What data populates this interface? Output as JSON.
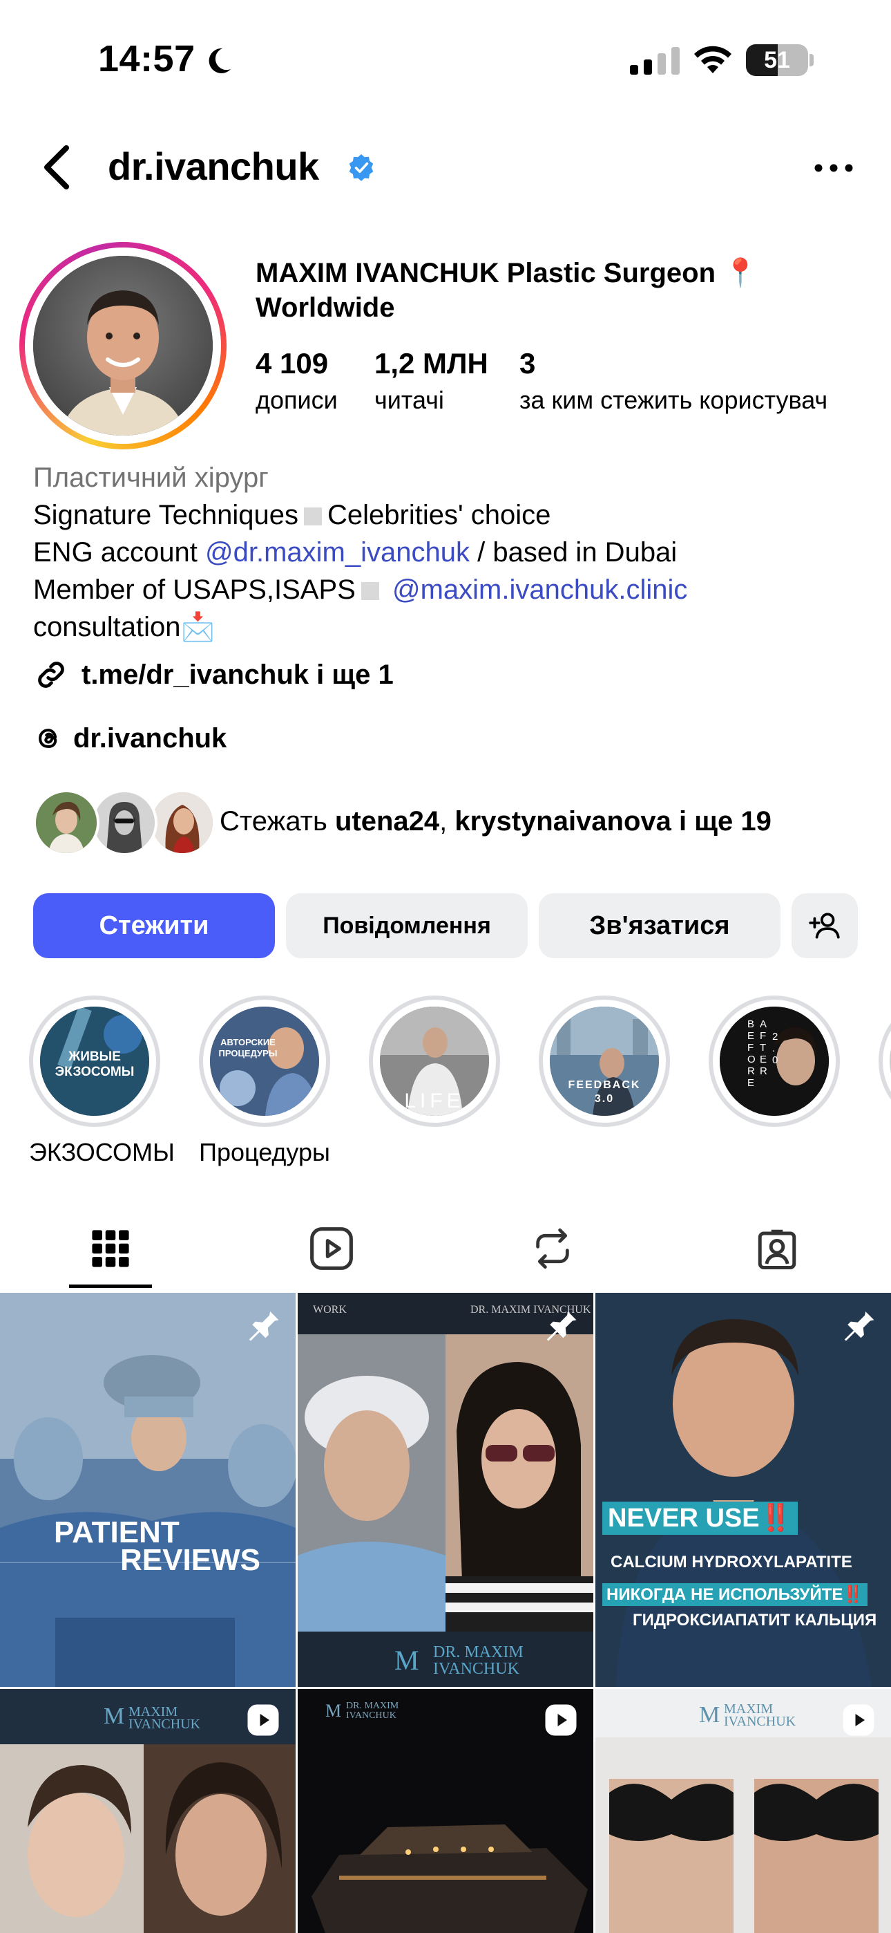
{
  "status_bar": {
    "time": "14:57",
    "battery": "51",
    "battery_level": 0.51
  },
  "header": {
    "username": "dr.ivanchuk"
  },
  "profile": {
    "full_name": "MAXIM IVANCHUK Plastic Surgeon 📍 Worldwide",
    "stats": [
      {
        "value": "4 109",
        "label": "дописи"
      },
      {
        "value": "1,2 МЛН",
        "label": "читачі"
      },
      {
        "value": "3",
        "label": "за ким стежить користувач"
      }
    ],
    "bio": {
      "category": "Пластичний хірург",
      "line1a": "Signature Techniques",
      "line1b": "Celebrities' choice",
      "line2a": "ENG account",
      "line2_link": "@dr.maxim_ivanchuk",
      "line2b": "/ based in Dubai",
      "line3a": "Member of USAPS,ISAPS",
      "line3_link": "@maxim.ivanchuk.clinic",
      "line4": "consultation📩"
    },
    "link": "t.me/dr_ivanchuk і ще 1",
    "threads": "dr.ivanchuk",
    "followed_by": {
      "prefix": "Стежать",
      "user1": "utena24",
      "sep": ",",
      "user2": "krystynaivanova",
      "suffix": "і ще 19"
    }
  },
  "actions": {
    "follow": "Стежити",
    "message": "Повідомлення",
    "contact": "Зв'язатися"
  },
  "highlights": [
    {
      "label": "ЭКЗОСОМЫ",
      "cover_text": "ЖИВЫЕ ЭКЗОСОМЫ"
    },
    {
      "label": "Процедуры",
      "cover_text": "АВТОРСКИЕ ПРОЦЕДУРЫ"
    },
    {
      "label": "",
      "cover_text": "LIFE"
    },
    {
      "label": "",
      "cover_text": "FEEDBACK 3.0"
    },
    {
      "label": "",
      "cover_text": "BEFORE AFTER 2.0"
    }
  ],
  "posts": {
    "post1": {
      "line1": "PATIENT",
      "line2": "REVIEWS"
    },
    "post2": {
      "top_left": "WORK",
      "top_right": "DR. MAXIM IVANCHUK",
      "logo": "DR. MAXIM IVANCHUK"
    },
    "post3": {
      "line1": "NEVER USE‼️",
      "line2": "CALCIUM HYDROXYLAPATITE",
      "line3": "НИКОГДА НЕ ИСПОЛЬЗУЙТЕ‼️",
      "line4": "ГИДРОКСИАПАТИТ КАЛЬЦИЯ"
    },
    "post4": {
      "logo": "MAXIM IVANCHUK"
    },
    "post5": {
      "logo": "DR. MAXIM IVANCHUK"
    },
    "post6": {
      "logo": "MAXIM IVANCHUK"
    }
  }
}
